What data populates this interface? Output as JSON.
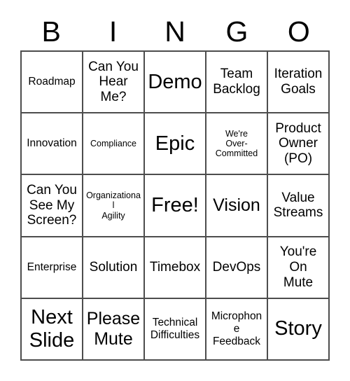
{
  "card": {
    "header_letters": [
      "B",
      "I",
      "N",
      "G",
      "O"
    ],
    "rows": [
      [
        {
          "text": "Roadmap",
          "size": "fs-sm"
        },
        {
          "text": "Can You\nHear\nMe?",
          "size": "fs-md"
        },
        {
          "text": "Demo",
          "size": "fs-xl"
        },
        {
          "text": "Team\nBacklog",
          "size": "fs-md"
        },
        {
          "text": "Iteration\nGoals",
          "size": "fs-md"
        }
      ],
      [
        {
          "text": "Innovation",
          "size": "fs-sm"
        },
        {
          "text": "Compliance",
          "size": "fs-xs"
        },
        {
          "text": "Epic",
          "size": "fs-xl"
        },
        {
          "text": "We're\nOver-\nCommitted",
          "size": "fs-xs"
        },
        {
          "text": "Product\nOwner\n(PO)",
          "size": "fs-md"
        }
      ],
      [
        {
          "text": "Can You\nSee My\nScreen?",
          "size": "fs-md"
        },
        {
          "text": "Organizational\nAgility",
          "size": "fs-xs"
        },
        {
          "text": "Free!",
          "size": "fs-xl"
        },
        {
          "text": "Vision",
          "size": "fs-lg"
        },
        {
          "text": "Value\nStreams",
          "size": "fs-md"
        }
      ],
      [
        {
          "text": "Enterprise",
          "size": "fs-sm"
        },
        {
          "text": "Solution",
          "size": "fs-md"
        },
        {
          "text": "Timebox",
          "size": "fs-md"
        },
        {
          "text": "DevOps",
          "size": "fs-md"
        },
        {
          "text": "You're\nOn\nMute",
          "size": "fs-md"
        }
      ],
      [
        {
          "text": "Next\nSlide",
          "size": "fs-xl"
        },
        {
          "text": "Please\nMute",
          "size": "fs-lg"
        },
        {
          "text": "Technical\nDifficulties",
          "size": "fs-sm"
        },
        {
          "text": "Microphone\nFeedback",
          "size": "fs-sm"
        },
        {
          "text": "Story",
          "size": "fs-xl"
        }
      ]
    ],
    "free_space": "Free!",
    "colors": {
      "background": "#ffffff",
      "text": "#000000",
      "grid_line": "#4d4d4d"
    }
  }
}
